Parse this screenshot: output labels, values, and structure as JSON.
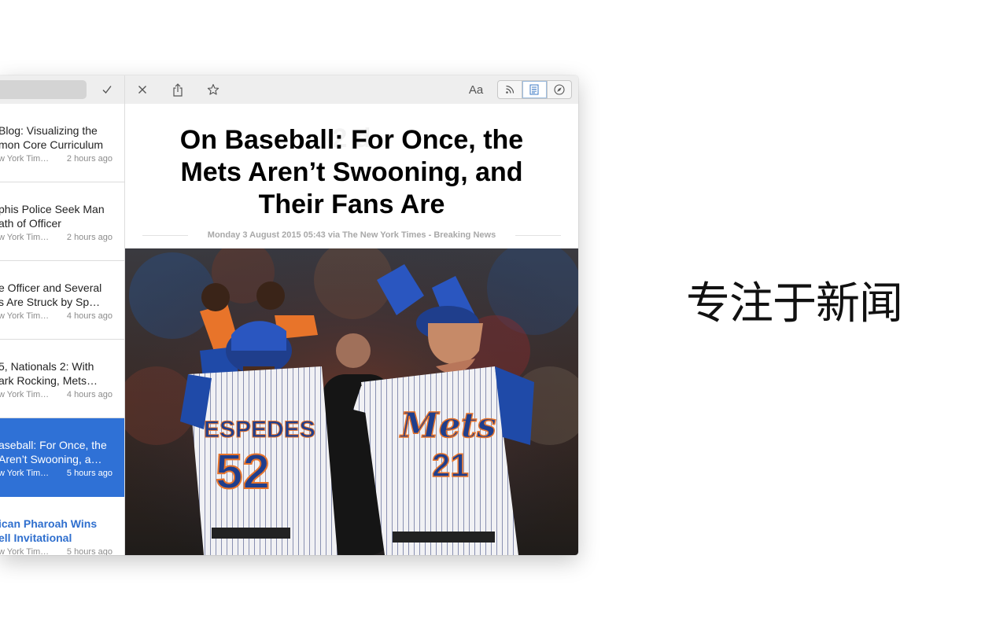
{
  "toolbar": {
    "font_label": "Aa"
  },
  "icons": {
    "mark_read": "checkmark-icon",
    "close": "close-icon",
    "share": "share-icon",
    "star": "star-icon",
    "rss": "rss-icon",
    "reader": "reader-view-icon",
    "web": "compass-icon"
  },
  "colors": {
    "selection": "#2f71d6",
    "unread_title": "#2f6fce",
    "toolbar_bg": "#eeeeee"
  },
  "items": [
    {
      "line1": "Blog: Visualizing the",
      "line2": "mon Core Curriculum",
      "source": "w York Tim…",
      "time": "2 hours ago"
    },
    {
      "line1": "phis Police Seek Man",
      "line2": "ath of Officer",
      "source": "w York Tim…",
      "time": "2 hours ago"
    },
    {
      "line1": "e Officer and Several",
      "line2": "s Are Struck by Sp…",
      "source": "w York Tim…",
      "time": "4 hours ago"
    },
    {
      "line1": "5, Nationals 2: With",
      "line2": "ark Rocking, Mets…",
      "source": "w York Tim…",
      "time": "4 hours ago"
    },
    {
      "line1": "aseball: For Once, the",
      "line2": "Aren’t Swooning, a…",
      "source": "w York Tim…",
      "time": "5 hours ago"
    },
    {
      "line1": "ican Pharoah Wins",
      "line2": "ell Invitational",
      "source": "w York Tim…",
      "time": "5 hours ago"
    }
  ],
  "article": {
    "ghost_title": "2                                    d",
    "title": "On Baseball: For Once, the Mets Aren’t Swooning, and Their Fans Are",
    "meta": "Monday 3 August 2015 05:43 via The New York Times - Breaking News",
    "jersey_left_name": "ESPEDES",
    "jersey_left_number": "52",
    "jersey_right_script": "Mets",
    "jersey_right_number": "21"
  },
  "tagline": "专注于新闻"
}
